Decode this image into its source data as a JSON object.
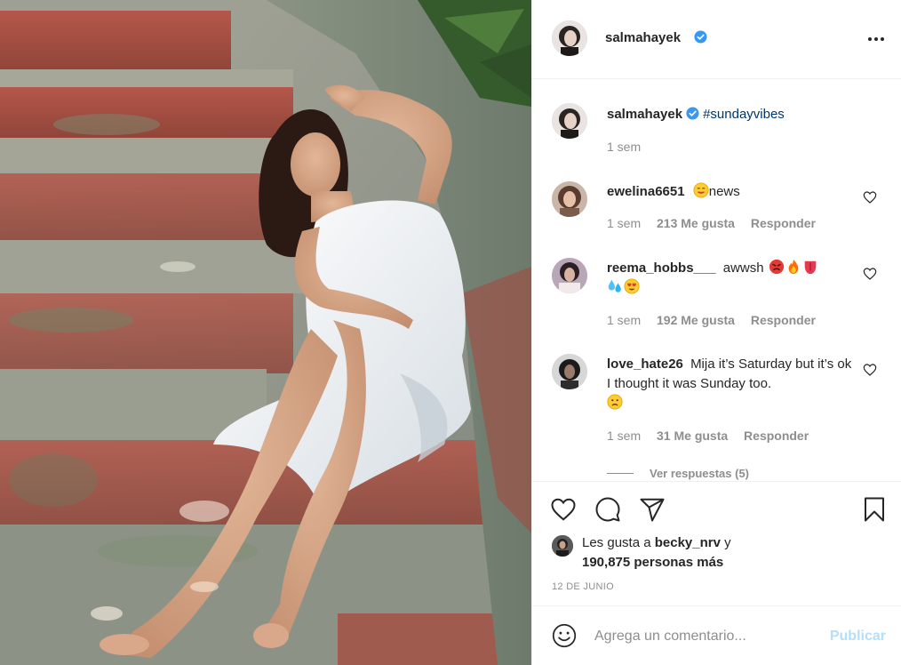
{
  "post": {
    "author": "salmahayek",
    "caption_hashtag": "#sundayvibes",
    "caption_time": "1 sem",
    "date": "12 DE JUNIO"
  },
  "comments": [
    {
      "user": "ewelina6651",
      "emojis": [
        "smiling-face"
      ],
      "text": "news",
      "time": "1 sem",
      "likes": "213 Me gusta",
      "reply": "Responder"
    },
    {
      "user": "reema_hobbs___",
      "text": "awwsh",
      "emojis": [
        "angry-face",
        "fire",
        "tongue",
        "sweat-droplets",
        "heart-eyes"
      ],
      "time": "1 sem",
      "likes": "192 Me gusta",
      "reply": "Responder"
    },
    {
      "user": "love_hate26",
      "text": "Mija it’s Saturday but it’s ok I thought it was Sunday too.",
      "emojis": [
        "sad-face"
      ],
      "time": "1 sem",
      "likes": "31 Me gusta",
      "reply": "Responder"
    }
  ],
  "view_replies": "Ver respuestas (5)",
  "likes": {
    "prefix": "Les gusta a",
    "first_user": "becky_nrv",
    "connector": "y",
    "count_text": "190,875 personas más"
  },
  "compose": {
    "placeholder": "Agrega un comentario...",
    "publish_label": "Publicar"
  },
  "icons": {
    "verified": "verified-badge-icon",
    "more": "more-options-icon",
    "like": "heart-icon",
    "comment": "comment-icon",
    "share": "share-icon",
    "save": "bookmark-icon",
    "emoji": "emoji-icon"
  },
  "colors": {
    "verified_blue": "#3897f0",
    "hashtag": "#00376b",
    "muted": "#8e8e8e",
    "publish_disabled": "#b2dffc"
  }
}
